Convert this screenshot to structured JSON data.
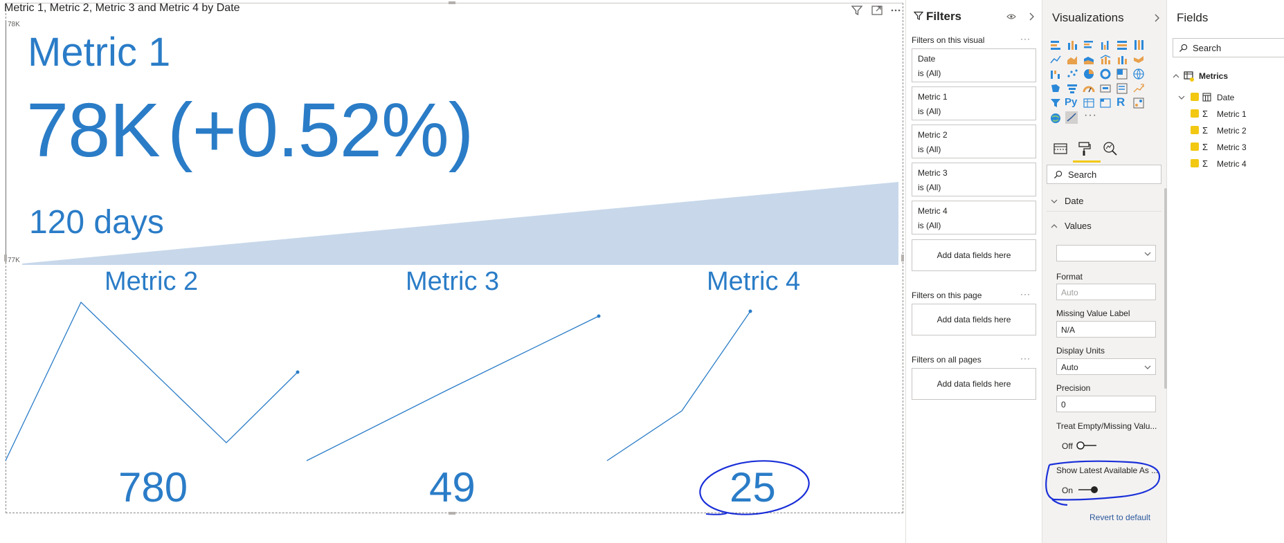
{
  "visual": {
    "title": "Metric 1, Metric 2, Metric 3 and Metric 4 by Date",
    "axis_top": "78K",
    "axis_bottom": "77K",
    "metric1": {
      "name": "Metric 1",
      "value": "78K",
      "change": "(+0.52%)",
      "period": "120 days"
    },
    "kpis": [
      {
        "name": "Metric 2",
        "value": "780"
      },
      {
        "name": "Metric 3",
        "value": "49"
      },
      {
        "name": "Metric 4",
        "value": "25"
      }
    ],
    "colors": {
      "accent": "#2a7cc7",
      "area": "#c8d8ea",
      "annotation": "#1a2fd8"
    }
  },
  "filters": {
    "title": "Filters",
    "on_visual_label": "Filters on this visual",
    "cards": [
      {
        "field": "Date",
        "state": "is (All)"
      },
      {
        "field": "Metric 1",
        "state": "is (All)"
      },
      {
        "field": "Metric 2",
        "state": "is (All)"
      },
      {
        "field": "Metric 3",
        "state": "is (All)"
      },
      {
        "field": "Metric 4",
        "state": "is (All)"
      }
    ],
    "add_fields": "Add data fields here",
    "on_page_label": "Filters on this page",
    "all_pages_label": "Filters on all pages",
    "more": "···"
  },
  "visualizations": {
    "title": "Visualizations",
    "search_placeholder": "Search",
    "sections": {
      "date": "Date",
      "values": "Values"
    },
    "format_label": "Format",
    "format_value": "Auto",
    "missing_label": "Missing Value Label",
    "missing_value": "N/A",
    "display_units_label": "Display Units",
    "display_units_value": "Auto",
    "precision_label": "Precision",
    "precision_value": "0",
    "treat_empty_label": "Treat Empty/Missing Valu...",
    "treat_empty_state": "Off",
    "show_latest_label": "Show Latest Available As ...",
    "show_latest_state": "On",
    "revert": "Revert to default",
    "more_visuals": "···",
    "py_label": "Py",
    "r_label": "R"
  },
  "fields": {
    "title": "Fields",
    "search_placeholder": "Search",
    "table": "Metrics",
    "items": [
      "Date",
      "Metric 1",
      "Metric 2",
      "Metric 3",
      "Metric 4"
    ]
  }
}
